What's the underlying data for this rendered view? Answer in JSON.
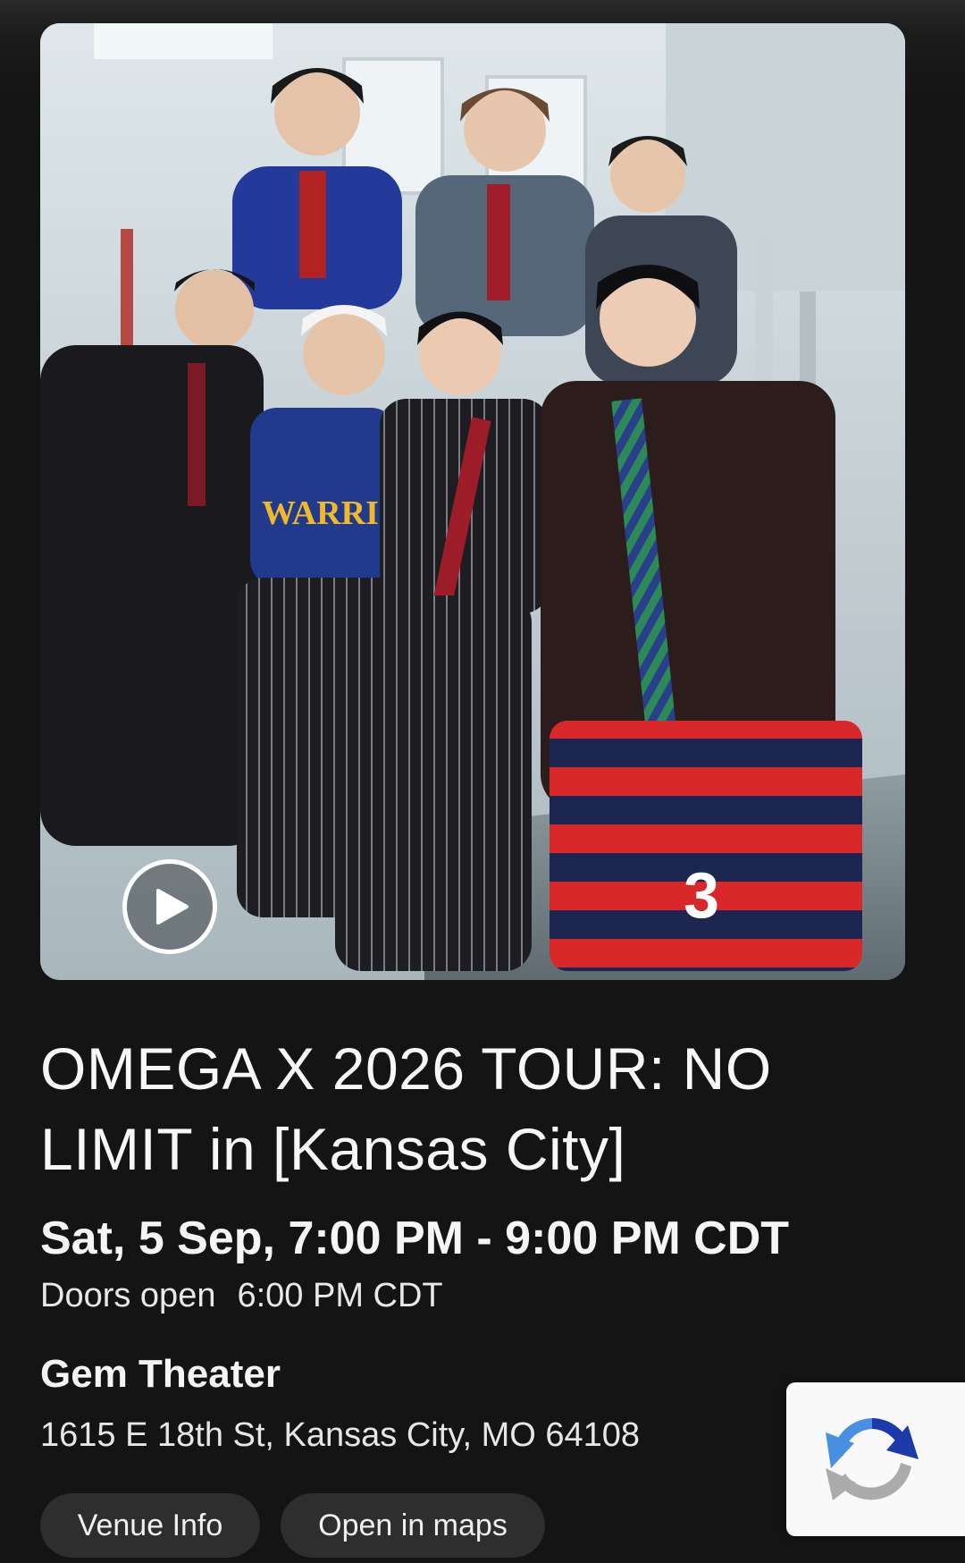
{
  "event": {
    "title": "OMEGA X 2026 TOUR: NO LIMIT in [Kansas City]",
    "datetime": "Sat, 5 Sep, 7:00 PM - 9:00 PM CDT",
    "doors_label": "Doors open",
    "doors_time": "6:00 PM CDT"
  },
  "venue": {
    "name": "Gem Theater",
    "address": "1615 E 18th St, Kansas City, MO 64108"
  },
  "buttons": {
    "venue_info": "Venue Info",
    "open_in_maps": "Open in maps"
  },
  "hero": {
    "jersey_text": "WARRIORS",
    "shorts_number": "3"
  },
  "icons": {
    "play": "play-icon",
    "recaptcha": "recaptcha-icon"
  },
  "colors": {
    "background": "#141414",
    "chip": "#2e2e2e",
    "text": "#f2f2f2"
  }
}
